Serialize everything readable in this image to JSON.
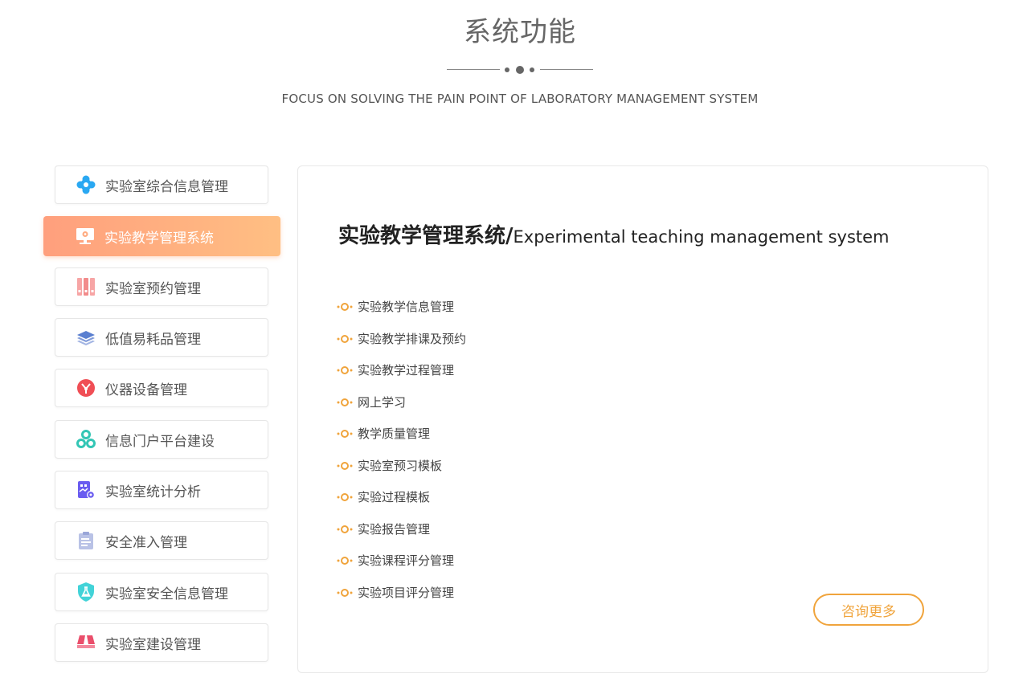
{
  "header": {
    "title": "系统功能",
    "subtitle": "FOCUS ON SOLVING THE PAIN POINT OF LABORATORY MANAGEMENT SYSTEM"
  },
  "sidebar": {
    "items": [
      {
        "label": "实验室综合信息管理",
        "icon": "gear-flower-icon",
        "color": "#2aa8f2"
      },
      {
        "label": "实验教学管理系统",
        "icon": "monitor-gear-icon",
        "color": "#ffffff",
        "active": true
      },
      {
        "label": "实验室预约管理",
        "icon": "folders-icon",
        "color": "#f28b8b"
      },
      {
        "label": "低值易耗品管理",
        "icon": "layers-icon",
        "color": "#5a7fd0"
      },
      {
        "label": "仪器设备管理",
        "icon": "instrument-icon",
        "color": "#f04e55"
      },
      {
        "label": "信息门户平台建设",
        "icon": "nodes-icon",
        "color": "#33c6b5"
      },
      {
        "label": "实验室统计分析",
        "icon": "chart-gear-icon",
        "color": "#6a5cf0"
      },
      {
        "label": "安全准入管理",
        "icon": "clipboard-icon",
        "color": "#b9c2e6"
      },
      {
        "label": "实验室安全信息管理",
        "icon": "shield-flask-icon",
        "color": "#42d3d8"
      },
      {
        "label": "实验室建设管理",
        "icon": "build-icon",
        "color": "#ea4e6b"
      }
    ]
  },
  "panel": {
    "title_cn": "实验教学管理系统/",
    "title_en": "Experimental teaching management system",
    "features": [
      "实验教学信息管理",
      "实验教学排课及预约",
      "实验教学过程管理",
      "网上学习",
      "教学质量管理",
      "实验室预习模板",
      "实验过程模板",
      "实验报告管理",
      "实验课程评分管理",
      "实验项目评分管理"
    ],
    "consult_label": "咨询更多"
  },
  "colors": {
    "accent": "#f0a43c",
    "active_gradient_start": "#ff9f7d",
    "active_gradient_end": "#ffbf83"
  }
}
